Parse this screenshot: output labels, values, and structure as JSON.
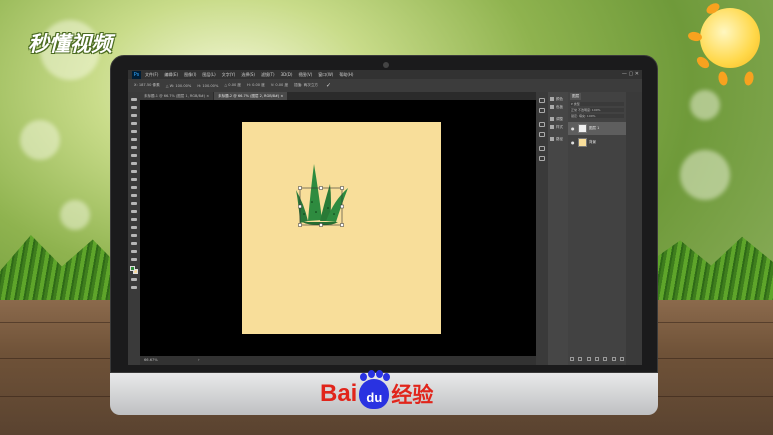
{
  "brand": {
    "text": "秒懂视频"
  },
  "footer": {
    "baidu_prefix": "Bai",
    "baidu_paw": "du",
    "baidu_suffix": "经验"
  },
  "photoshop": {
    "app_icon": "Ps",
    "menu": [
      "文件(F)",
      "编辑(E)",
      "图像(I)",
      "图层(L)",
      "文字(Y)",
      "选择(S)",
      "滤镜(T)",
      "3D(D)",
      "视图(V)",
      "窗口(W)",
      "帮助(H)"
    ],
    "window_controls": "—  ▢  ✕",
    "options": [
      "X: 187.50 像素",
      "△ W: 100.00%",
      "H: 100.00%",
      "△ 0.00 度",
      "H: 0.00 度",
      "V: 0.00 度",
      "插值: 两次立方"
    ],
    "tabs": [
      {
        "label": "未标题-1 @ 66.7% (图层 1, RGB/8#) ×",
        "active": false
      },
      {
        "label": "未标题-2 @ 66.7% (图层 2, RGB/8#) ×",
        "active": true
      }
    ],
    "status": {
      "zoom": "66.67%",
      "arrow": "›"
    },
    "properties": [
      "颜色",
      "色板",
      "调整",
      "样式",
      "路径"
    ],
    "layers": {
      "tab": "图层",
      "controls": [
        "P 类型",
        "正常        不透明度: 100%",
        "锁定:        填充: 100%"
      ],
      "items": [
        {
          "name": "图层 1",
          "visible": "●",
          "selected": true,
          "thumb_color": "#f0f0f0"
        },
        {
          "name": "背景",
          "visible": "●",
          "selected": false,
          "thumb_color": "#f8de9a"
        }
      ]
    },
    "colors": {
      "foreground": "#2e8b3a",
      "background": "#f4d7a0",
      "document": "#f8de9a"
    }
  }
}
